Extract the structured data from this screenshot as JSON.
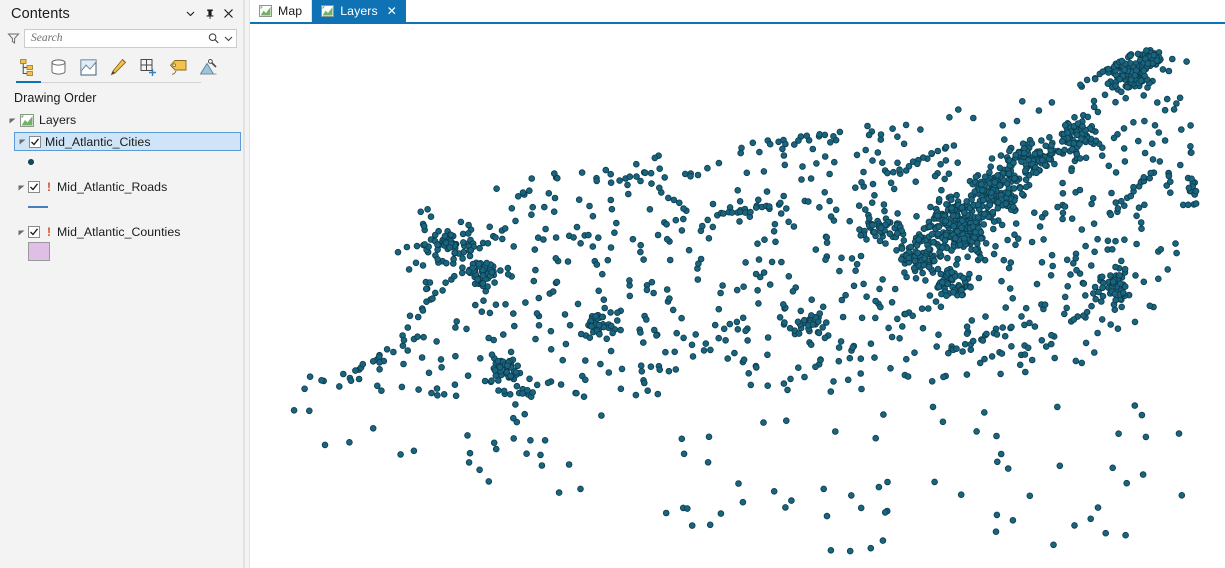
{
  "contents_pane": {
    "title": "Contents",
    "header_buttons": [
      {
        "name": "menu-chevron",
        "icon": "chevron-down-icon"
      },
      {
        "name": "pin",
        "icon": "pin-icon"
      },
      {
        "name": "close",
        "icon": "close-icon"
      }
    ],
    "search": {
      "placeholder": "Search",
      "value": "",
      "filter_icon": "filter-icon",
      "search_icon": "search-icon",
      "dropdown_icon": "chevron-down-icon"
    },
    "toolbar": {
      "active_index": 0,
      "buttons": [
        {
          "label": "List By Drawing Order",
          "icon": "list-drawing-order-icon"
        },
        {
          "label": "List By Data Source",
          "icon": "data-source-icon"
        },
        {
          "label": "List By Selection",
          "icon": "selection-icon"
        },
        {
          "label": "List By Editing",
          "icon": "pencil-icon"
        },
        {
          "label": "List By Snapping",
          "icon": "grid-plus-icon"
        },
        {
          "label": "List By Labeling",
          "icon": "label-tag-icon"
        },
        {
          "label": "List By Diagrams",
          "icon": "charts-icon"
        }
      ]
    },
    "drawing_order_label": "Drawing Order",
    "tree": {
      "group": {
        "label": "Layers",
        "icon": "map-group-icon",
        "expanded": true
      },
      "layers": [
        {
          "label": "Mid_Atlantic_Cities",
          "checked": true,
          "selected": true,
          "warning": false,
          "expanded": true,
          "symbol_type": "point",
          "symbol_color": "#0f4b5e"
        },
        {
          "label": "Mid_Atlantic_Roads",
          "checked": true,
          "selected": false,
          "warning": true,
          "expanded": true,
          "symbol_type": "line",
          "symbol_color": "#4a7ebb"
        },
        {
          "label": "Mid_Atlantic_Counties",
          "checked": true,
          "selected": false,
          "warning": true,
          "expanded": true,
          "symbol_type": "polygon",
          "symbol_color": "#dfbfe6"
        }
      ]
    }
  },
  "map_view": {
    "tabs": [
      {
        "label": "Map",
        "active": false,
        "closable": false,
        "icon": "map-tab-icon"
      },
      {
        "label": "Layers",
        "active": true,
        "closable": true,
        "icon": "map-tab-icon",
        "close_glyph": "✕"
      }
    ],
    "accent_color": "#0f72b5",
    "background": "#ffffff",
    "point_symbol": {
      "fill": "#19647e",
      "stroke": "#0c3a4a",
      "radius": 2.9
    }
  }
}
